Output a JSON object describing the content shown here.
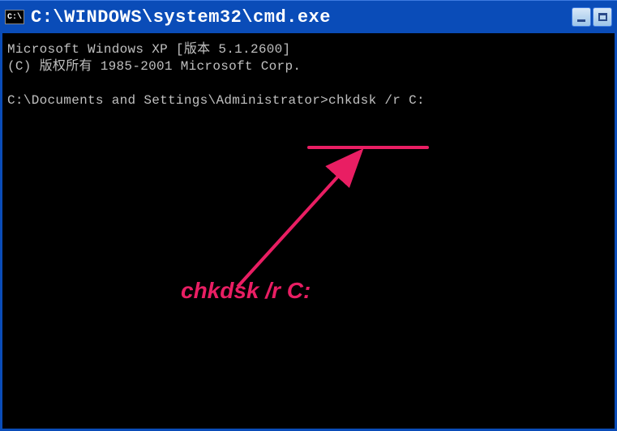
{
  "titlebar": {
    "icon_text": "C:\\",
    "title": "C:\\WINDOWS\\system32\\cmd.exe"
  },
  "console": {
    "line1": "Microsoft Windows XP [版本 5.1.2600]",
    "line2": "(C) 版权所有 1985-2001 Microsoft Corp.",
    "prompt_line": "C:\\Documents and Settings\\Administrator>chkdsk /r C:"
  },
  "annotation": {
    "text": "chkdsk /r C:"
  }
}
